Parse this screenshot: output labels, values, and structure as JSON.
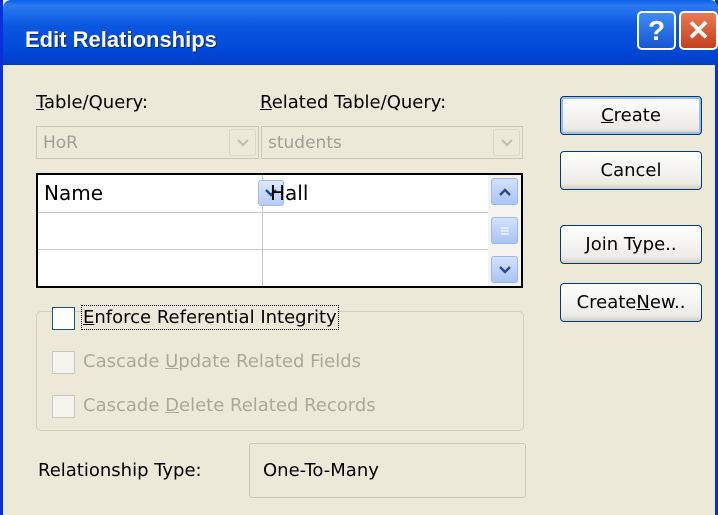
{
  "window": {
    "title": "Edit Relationships",
    "help_label": "?",
    "close_label": "✕"
  },
  "labels": {
    "table_query": [
      "",
      "T",
      "able/Query:"
    ],
    "related_table_query": [
      "",
      "R",
      "elated Table/Query:"
    ]
  },
  "combos": {
    "table": {
      "value": "HoR",
      "icon": "chevron-down-icon"
    },
    "related": {
      "value": "students",
      "icon": "chevron-down-icon"
    }
  },
  "fields_grid": {
    "rows": [
      {
        "left": "Name",
        "right": "Hall"
      },
      {
        "left": "",
        "right": ""
      },
      {
        "left": "",
        "right": ""
      }
    ],
    "scroll_up_icon": "chevron-up-icon",
    "scroll_down_icon": "chevron-down-icon"
  },
  "options": {
    "enforce": {
      "parts": [
        "",
        "E",
        "nforce Referential Integrity"
      ],
      "checked": false,
      "enabled": true
    },
    "cascade_update": {
      "parts": [
        "Cascade ",
        "U",
        "pdate Related Fields"
      ],
      "checked": false,
      "enabled": false
    },
    "cascade_delete": {
      "parts": [
        "Cascade ",
        "D",
        "elete Related Records"
      ],
      "checked": false,
      "enabled": false
    }
  },
  "relationship": {
    "label": "Relationship Type:",
    "value": "One-To-Many"
  },
  "buttons": {
    "create": [
      "",
      "C",
      "reate"
    ],
    "cancel": [
      "Cancel",
      "",
      ""
    ],
    "join_type": [
      "",
      "J",
      "oin Type.."
    ],
    "create_new": [
      "Create ",
      "N",
      "ew.."
    ]
  },
  "colors": {
    "titlebar": "#0054e3",
    "dialog_bg": "#ece9d8",
    "disabled_text": "#aca899"
  }
}
